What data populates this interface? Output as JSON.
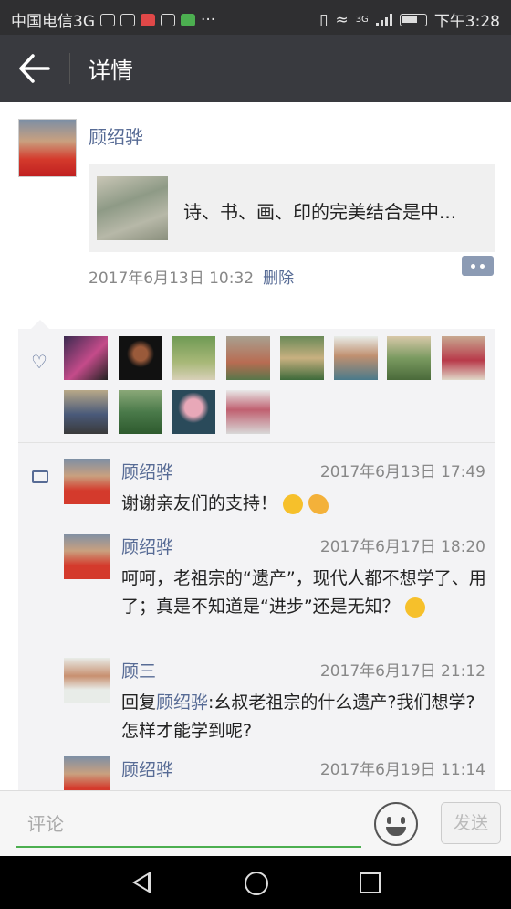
{
  "status_bar": {
    "carrier": "中国电信3G",
    "network": "3G",
    "time": "下午3:28"
  },
  "header": {
    "title": "详情"
  },
  "post": {
    "author": "顾绍骅",
    "share_text": "诗、书、画、印的完美结合是中...",
    "timestamp": "2017年6月13日 10:32",
    "delete_label": "删除"
  },
  "comments": [
    {
      "name": "顾绍骅",
      "time": "2017年6月13日 17:49",
      "text": "谢谢亲友们的支持！"
    },
    {
      "name": "顾绍骅",
      "time": "2017年6月17日 18:20",
      "text": "呵呵，老祖宗的“遗产”，现代人都不想学了、用了；真是不知道是“进步”还是无知？"
    },
    {
      "name": "顾三",
      "time": "2017年6月17日 21:12",
      "reply_prefix": "回复",
      "reply_to": "顾绍骅",
      "text": ":幺叔老祖宗的什么遗产?我们想学?怎样才能学到呢?"
    },
    {
      "name": "顾绍骅",
      "time": "2017年6月19日 11:14",
      "text": ""
    }
  ],
  "input_bar": {
    "placeholder": "评论",
    "send_label": "发送"
  },
  "icons": [
    "back-arrow-icon",
    "more-icon",
    "heart-icon",
    "comment-icon",
    "emoji-icon",
    "nav-back-icon",
    "nav-home-icon",
    "nav-recent-icon"
  ],
  "colors": {
    "link": "#576b95",
    "titlebar": "#393a3f",
    "accent": "#4caf50"
  }
}
